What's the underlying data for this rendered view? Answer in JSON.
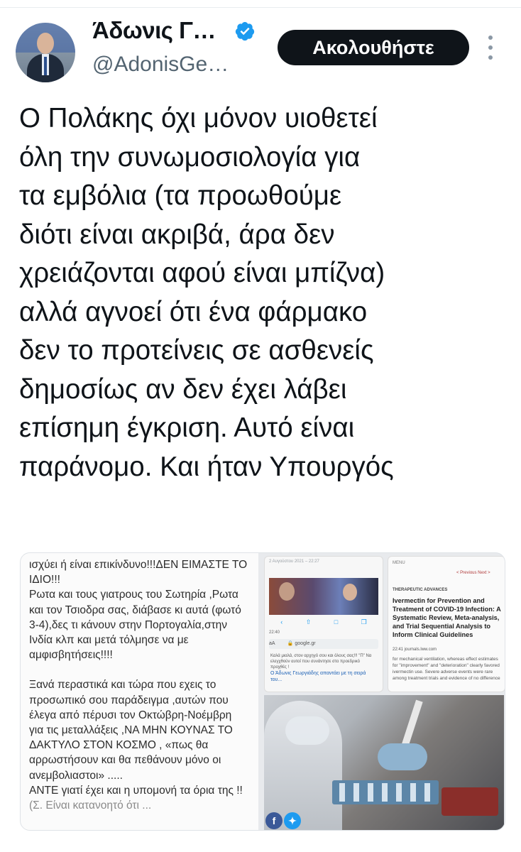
{
  "author": {
    "name": "Άδωνις Γ…",
    "handle": "@AdonisGe…",
    "verified": true
  },
  "follow_button": {
    "label": "Ακολουθήστε"
  },
  "tweet": {
    "lines": [
      "Ο Πολάκης όχι μόνον υιοθετεί",
      "όλη την συνωμοσιολογία για",
      "τα εμβόλια (τα προωθούμε",
      "διότι είναι ακριβά, άρα δεν",
      "χρειάζονται αφού είναι μπίζνα)",
      "αλλά αγνοεί ότι ένα φάρμακο",
      "δεν το προτείνεις σε ασθενείς",
      "δημοσίως αν δεν έχει λάβει",
      "επίσημη έγκριση. Αυτό είναι",
      "παράνομο. Και ήταν Υπουργός"
    ]
  },
  "media": {
    "screenshot_text": [
      "ισχύει ή είναι επικίνδυνο!!!ΔΕΝ ΕΙΜΑΣΤΕ ΤΟ",
      "ΙΔΙΟ!!!",
      "Ρωτα και τους γιατρους του Σωτηρία ,Ρωτα",
      "και τον Τσιοδρα σας, διάβασε κι αυτά (φωτό",
      "3-4),δες τι κάνουν στην Πορτογαλία,στην",
      "Ινδία κλπ και μετά τόλμησε να με",
      "αμφισβητήσεις!!!!",
      "",
      "Ξανά περαστικά και τώρα που εχεις το",
      "προσωπικό σου παράδειγμα ,αυτών που",
      "έλεγα από πέρυσι τον Οκτώβρη-Νοέμβρη",
      "για τις μεταλλάξεις ,ΝΑ ΜΗΝ ΚΟΥΝΑΣ ΤΟ",
      "ΔΑΚΤΥΛΟ ΣΤΟΝ ΚΟΣΜΟ , «πως θα",
      "αρρωστήσουν και θα πεθάνουν μόνο οι",
      "ανεμβολιαστοι» .....",
      "ΑΝΤΕ γιατί έχει και η υπομονή τα όρια της !!"
    ],
    "screenshot_cut": "(Σ. Είναι κατανοητό ότι ...",
    "phone1": {
      "date": "2 Αυγούστου 2021 – 22:27",
      "status": "22:40",
      "url_prefix": "aA",
      "url": "google.gr",
      "snippet": "Καλά μιαλά, στον αρχηγό σου και όλους σας!!! \"Π\" Να ελεγχθούν αυτοί που συνάντησε στο προεδρικό προχθές !",
      "link": "Ο Άδωνις Γεωργιάδης απαντάει με τη σειρά του..."
    },
    "phone2": {
      "menu": "MENU",
      "nav": "< Previous   Next >",
      "journal": "THERAPEUTIC ADVANCES",
      "title": "Ivermectin for Prevention and Treatment of COVID-19 Infection: A Systematic Review, Meta-analysis, and Trial Sequential Analysis to Inform Clinical Guidelines",
      "status": "22:41   journals.lww.com",
      "abstract": "for mechanical ventilation, whereas effect estimates for \"improvement\" and \"deterioration\" clearly favored ivermectin use. Severe adverse events were rare among treatment trials and evidence of no difference"
    },
    "share_icons": [
      "facebook-icon",
      "twitter-icon"
    ]
  },
  "colors": {
    "follow_bg": "#0f1419",
    "verified": "#1d9bf0",
    "handle": "#536471"
  }
}
